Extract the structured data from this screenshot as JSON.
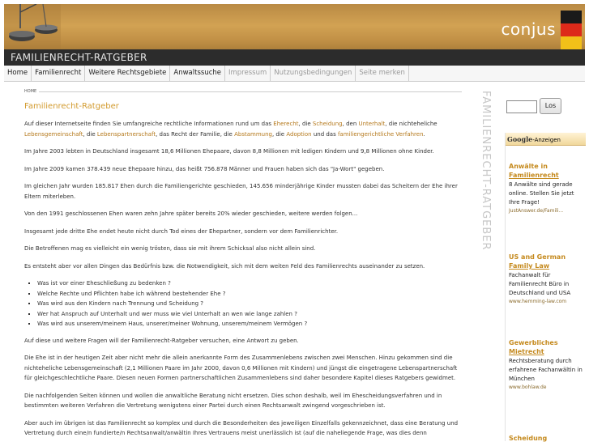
{
  "header": {
    "logo": "conjus",
    "title": "FAMILIENRECHT-RATGEBER",
    "flag_colors": [
      "#1a1a1a",
      "#dd2a1a",
      "#f2c019"
    ]
  },
  "nav": [
    {
      "label": "Home",
      "enabled": true
    },
    {
      "label": "Familienrecht",
      "enabled": true
    },
    {
      "label": "Weitere Rechtsgebiete",
      "enabled": true
    },
    {
      "label": "Anwaltssuche",
      "enabled": true
    },
    {
      "label": "Impressum",
      "enabled": false
    },
    {
      "label": "Nutzungsbedingungen",
      "enabled": false
    },
    {
      "label": "Seite merken",
      "enabled": false
    }
  ],
  "breadcrumb": "HOME",
  "page_title": "Familienrecht-Ratgeber",
  "vertical_title": "FAMILIENRECHT-RATGEBER",
  "intro": {
    "before": "Auf dieser Internetseite finden Sie umfangreiche rechtliche Informationen rund um das ",
    "link1": "Eherecht",
    "sep1": ", die ",
    "link2": "Scheidung",
    "sep2": ", den ",
    "link3": "Unterhalt",
    "sep3": ", die nichteheliche ",
    "link4": "Lebensgemeinschaft",
    "sep4": ", die ",
    "link5": "Lebenspartnerschaft",
    "sep5": ", das Recht der Familie, die ",
    "link6": "Abstammung",
    "sep6": ", die ",
    "link7": "Adoption",
    "sep7": " und das ",
    "link8": "familiengerichtliche Verfahren",
    "after": "."
  },
  "paragraphs": [
    "Im Jahre 2003 lebten in Deutschland insgesamt 18,6 Millionen Ehepaare, davon 8,8 Millionen mit ledigen Kindern und 9,8 Millionen ohne Kinder.",
    "Im Jahre 2009 kamen 378.439 neue Ehepaare hinzu, das heißt 756.878 Männer und Frauen haben sich das \"Ja-Wort\" gegeben.",
    "Im gleichen Jahr wurden 185.817 Ehen durch die Familiengerichte geschieden, 145.656 minderjährige Kinder mussten dabei das Scheitern der Ehe ihrer Eltern miterleben.",
    "Von den 1991 geschlossenen Ehen waren zehn Jahre später bereits 20% wieder geschieden, weitere werden folgen...",
    "Insgesamt jede dritte Ehe endet heute nicht durch Tod eines der Ehepartner, sondern vor dem Familienrichter.",
    "Die Betroffenen mag es vielleicht ein wenig trösten, dass sie mit ihrem Schicksal also nicht allein sind.",
    "Es entsteht aber vor allen Dingen das Bedürfnis bzw. die Notwendigkeit, sich mit dem weiten Feld des Familienrechts auseinander zu setzen."
  ],
  "questions": [
    "Was ist vor einer Eheschließung zu bedenken ?",
    "Welche Rechte und Pflichten habe ich während bestehender Ehe ?",
    "Was wird aus den Kindern nach Trennung und Scheidung ?",
    "Wer hat Anspruch auf Unterhalt und wer muss wie viel Unterhalt an wen wie lange zahlen ?",
    "Was wird aus unserem/meinem Haus, unserer/meiner Wohnung, unserem/meinem Vermögen ?"
  ],
  "paragraphs2": [
    "Auf diese und weitere Fragen will der Familienrecht-Ratgeber versuchen, eine Antwort zu geben.",
    "Die Ehe ist in der heutigen Zeit aber nicht mehr die allein anerkannte Form des Zusammenlebens zwischen zwei Menschen. Hinzu gekommen sind die nichteheliche Lebensgemeinschaft (2,1 Millionen Paare im Jahr 2000, davon 0,6 Millionen mit Kindern) und jüngst die eingetragene Lebenspartnerschaft für gleichgeschlechtliche Paare. Diesen neuen Formen partnerschaftlichen Zusammenlebens sind daher besondere Kapitel dieses Ratgebers gewidmet.",
    "Die nachfolgenden Seiten können und wollen die anwaltliche Beratung nicht ersetzen. Dies schon deshalb, weil im Ehescheidungsverfahren und in bestimmten weiteren Verfahren die Vertretung wenigstens einer Partei durch einen Rechtsanwalt zwingend vorgeschrieben ist.",
    "Aber auch im übrigen ist das Familienrecht so komplex und durch die Besonderheiten des jeweiligen Einzelfalls gekennzeichnet, dass eine Beratung und Vertretung durch eine/n fundierte/n Rechtsanwalt/anwältin Ihres Vertrauens meist unerlässlich ist (auf die naheliegende Frage, was dies denn"
  ],
  "search": {
    "value": "",
    "button": "Los"
  },
  "ads": {
    "header_brand": "Google",
    "header_label": "-Anzeigen",
    "items": [
      {
        "title_line1": "Anwälte in",
        "title_line2": "Familienrecht",
        "body": "8 Anwälte sind gerade online. Stellen Sie jetzt Ihre Frage!",
        "url": "JustAnswer.de/Famili..."
      },
      {
        "title_line1": "US and German",
        "title_line2": "Family Law",
        "body": "Fachanwalt für Familienrecht Büro in Deutschland und USA",
        "url": "www.hemming-law.com"
      },
      {
        "title_line1": "Gewerbliches",
        "title_line2": "Mietrecht",
        "body": "Rechtsberatung durch erfahrene Fachanwältin in München",
        "url": "www.bohlaw.de"
      },
      {
        "title_line1": "Scheidung",
        "title_line2": "",
        "body": "",
        "url": ""
      }
    ]
  }
}
